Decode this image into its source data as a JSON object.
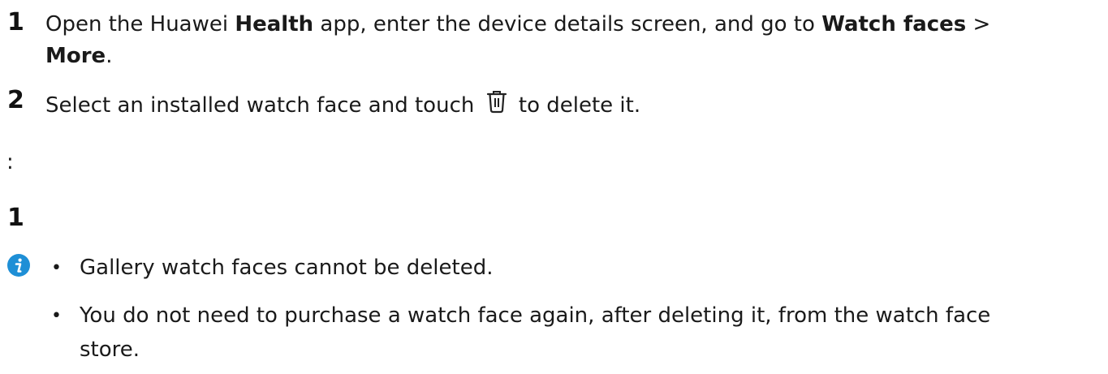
{
  "steps": [
    {
      "number": "1",
      "line1": {
        "t1": "Open the Huawei ",
        "b1": "Health",
        "t2": " app, enter the device details screen, and go to ",
        "b2": "Watch faces",
        "t3": " >"
      },
      "line2": {
        "b1": "More",
        "t1": "."
      }
    },
    {
      "number": "2",
      "before_icon": "Select an installed watch face and touch ",
      "icon": "trash-icon",
      "after_icon": " to delete it."
    }
  ],
  "stray_colon": ":",
  "stray_number": "1",
  "notes": {
    "icon": "info-icon",
    "icon_color": "#1e8fd6",
    "bullet": "•",
    "items": [
      {
        "line1": "Gallery watch faces cannot be deleted."
      },
      {
        "line1": "You do not need to purchase a watch face again, after deleting it, from the watch face",
        "line2": "store."
      }
    ]
  }
}
